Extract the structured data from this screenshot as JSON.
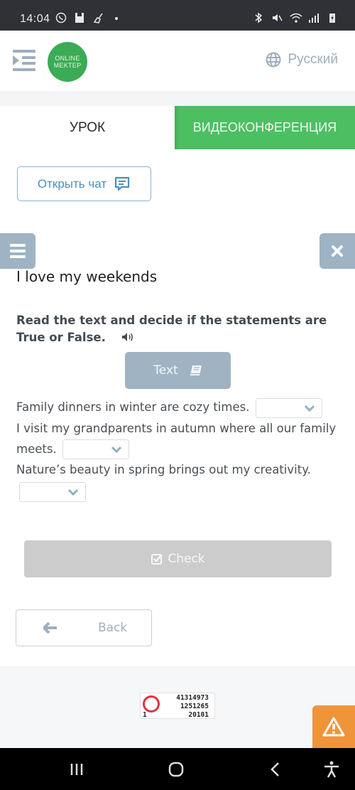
{
  "status_bar": {
    "time": "14:04",
    "left_icons": [
      "whatsapp-icon",
      "save-icon",
      "cleaner-icon",
      "dot-icon"
    ],
    "right_icons": [
      "bluetooth-icon",
      "mute-icon",
      "wifi-icon",
      "signal-icon",
      "battery-charging-icon"
    ]
  },
  "header": {
    "logo_line1": "ONLINE",
    "logo_line2": "MEKTEP",
    "language": "Русский"
  },
  "tabs": [
    {
      "label": "УРОК",
      "active": true
    },
    {
      "label": "ВИДЕОКОНФЕРЕНЦИЯ",
      "active": false
    }
  ],
  "chat_button": {
    "label": "Открыть чат"
  },
  "lesson": {
    "title": "I love my weekends",
    "instruction": "Read the text and decide if the statements are True or False.",
    "text_button": "Text",
    "statements": [
      {
        "text": "Family dinners in winter are cozy times.",
        "selected": ""
      },
      {
        "text": "I visit my grandparents in autumn where all our family meets.",
        "selected": ""
      },
      {
        "text": "Nature’s beauty in spring brings out my creativity.",
        "selected": ""
      }
    ],
    "check_button": "Check",
    "back_button": "Back"
  },
  "counter_widget": {
    "left_number": "1",
    "line1": "41314973",
    "line2": "1251265",
    "line3": "20101"
  },
  "colors": {
    "brand_green": "#3bab55",
    "tab_green": "#4dbf63",
    "accent_blue": "#4b8fbb",
    "slate": "#9fb3c3",
    "warning_orange": "#f0943a",
    "disabled_gray": "#cccccc"
  }
}
